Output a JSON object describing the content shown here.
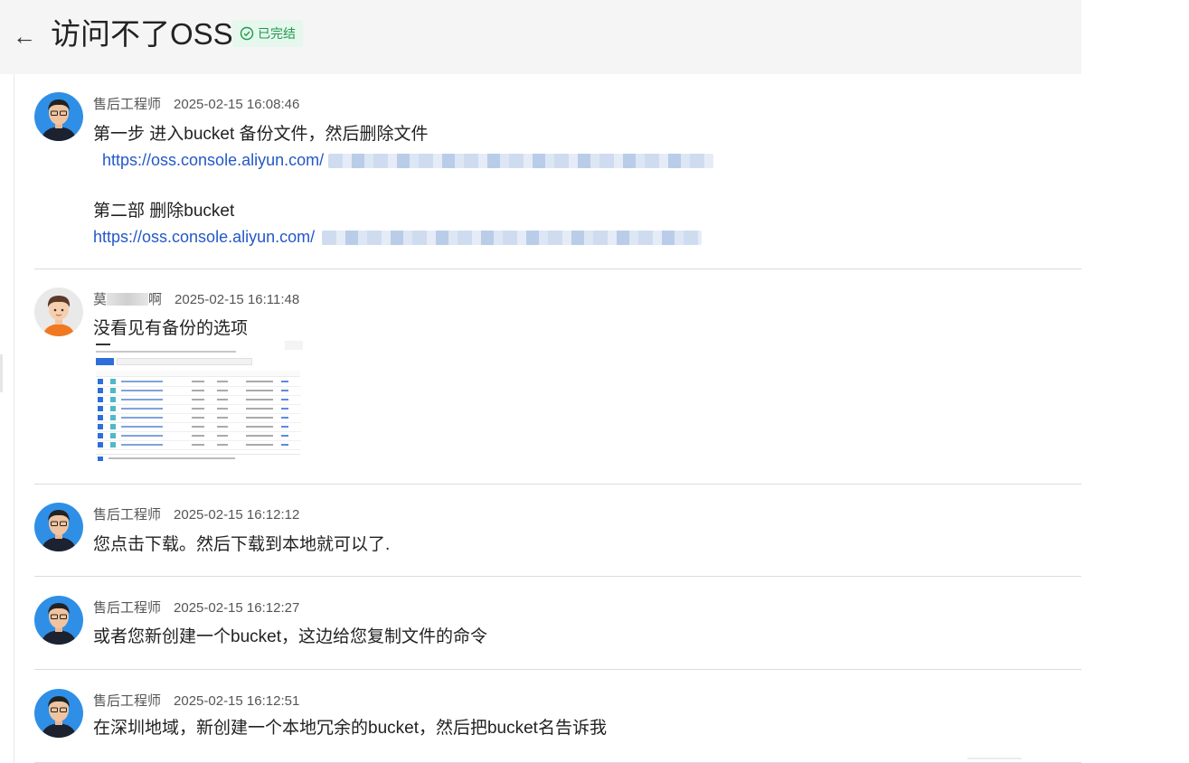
{
  "header": {
    "back_icon": "arrow-left-icon",
    "title": "访问不了OSS",
    "status": {
      "label": "已完结",
      "icon": "check-circle-icon",
      "color": "#1e9a4a",
      "background": "#e6f7ee"
    }
  },
  "colors": {
    "link": "#2458c8",
    "divider": "#dcdcdc",
    "header_bg": "#f5f5f5"
  },
  "messages": [
    {
      "author": "售后工程师",
      "time": "2025-02-15 16:08:46",
      "avatar": "engineer-avatar",
      "text": "第一步 进入bucket  备份文件，然后删除文件",
      "link1": "https://oss.console.aliyun.com/",
      "text2": "第二部 删除bucket",
      "link2": "https://oss.console.aliyun.com/"
    },
    {
      "author": "莫",
      "author_suffix": "啊",
      "time": "2025-02-15 16:11:48",
      "avatar": "customer-avatar",
      "text": "没看见有备份的选项",
      "attachment": "screenshot-thumbnail"
    },
    {
      "author": "售后工程师",
      "time": "2025-02-15 16:12:12",
      "avatar": "engineer-avatar",
      "text": "您点击下载。然后下载到本地就可以了."
    },
    {
      "author": "售后工程师",
      "time": "2025-02-15 16:12:27",
      "avatar": "engineer-avatar",
      "text": "或者您新创建一个bucket，这边给您复制文件的命令"
    },
    {
      "author": "售后工程师",
      "time": "2025-02-15 16:12:51",
      "avatar": "engineer-avatar",
      "text": "在深圳地域，新创建一个本地冗余的bucket，然后把bucket名告诉我"
    }
  ]
}
